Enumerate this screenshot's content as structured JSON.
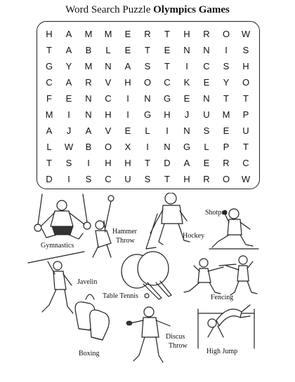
{
  "title": {
    "prefix": "Word Search Puzzle",
    "bold": "Olympics Games"
  },
  "grid": [
    [
      "H",
      "A",
      "M",
      "M",
      "E",
      "R",
      "T",
      "H",
      "R",
      "O",
      "W"
    ],
    [
      "T",
      "A",
      "B",
      "L",
      "E",
      "T",
      "E",
      "N",
      "N",
      "I",
      "S"
    ],
    [
      "G",
      "Y",
      "M",
      "N",
      "A",
      "S",
      "T",
      "I",
      "C",
      "S",
      "H"
    ],
    [
      "C",
      "A",
      "R",
      "V",
      "H",
      "O",
      "C",
      "K",
      "E",
      "Y",
      "O"
    ],
    [
      "F",
      "E",
      "N",
      "C",
      "I",
      "N",
      "G",
      "E",
      "N",
      "T",
      "T"
    ],
    [
      "M",
      "I",
      "N",
      "H",
      "I",
      "G",
      "H",
      "J",
      "U",
      "M",
      "P"
    ],
    [
      "A",
      "J",
      "A",
      "V",
      "E",
      "L",
      "I",
      "N",
      "S",
      "E",
      "U"
    ],
    [
      "L",
      "W",
      "B",
      "O",
      "X",
      "I",
      "N",
      "G",
      "L",
      "P",
      "T"
    ],
    [
      "T",
      "S",
      "I",
      "H",
      "H",
      "T",
      "D",
      "A",
      "E",
      "R",
      "C"
    ],
    [
      "D",
      "I",
      "S",
      "C",
      "U",
      "S",
      "T",
      "H",
      "R",
      "O",
      "W"
    ]
  ],
  "labels": {
    "gymnastics": "Gymnastics",
    "hammer_throw_1": "Hammer",
    "hammer_throw_2": "Throw",
    "hockey": "Hockey",
    "shotput": "Shotput",
    "javelin": "Javelin",
    "table_tennis": "Table Tennis",
    "fencing": "Fencing",
    "boxing": "Boxing",
    "discus_throw_1": "Discus",
    "discus_throw_2": "Throw",
    "high_jump": "High Jump"
  }
}
